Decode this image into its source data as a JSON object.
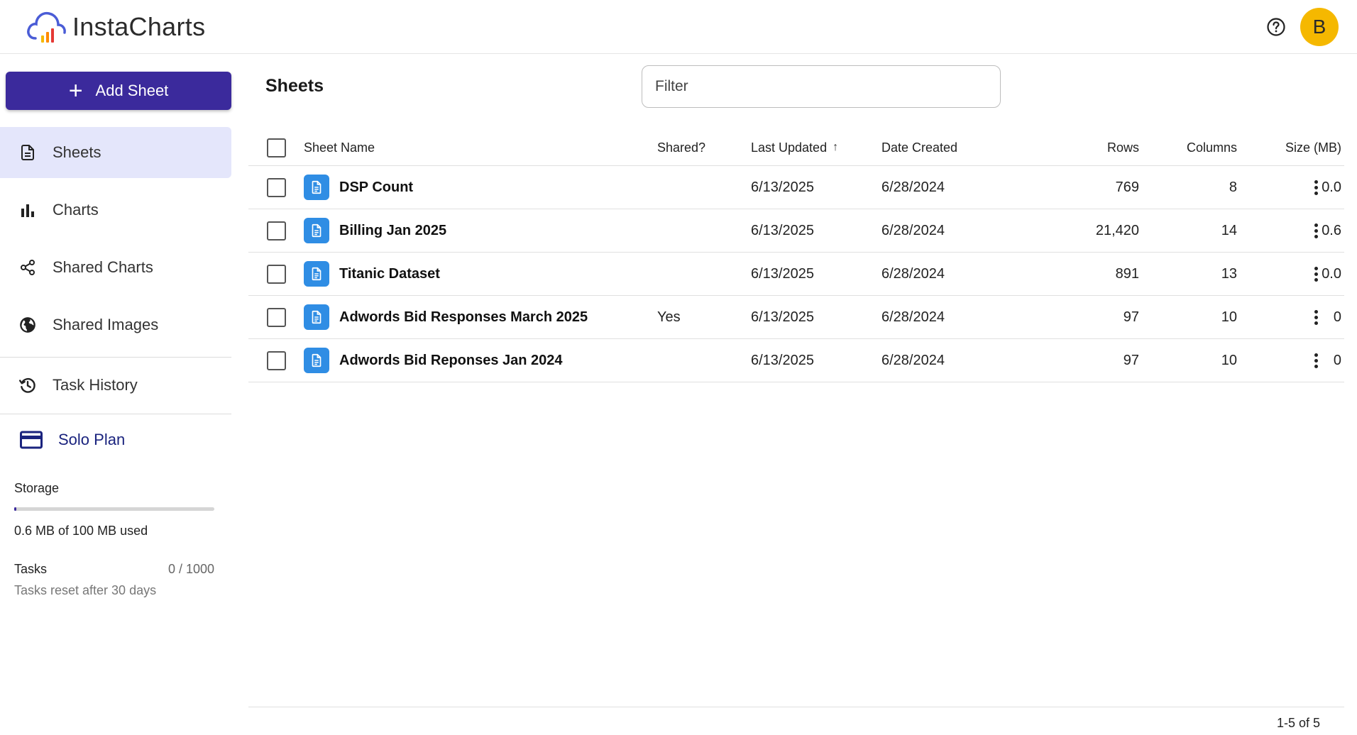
{
  "app": {
    "name": "InstaCharts",
    "user_initial": "B",
    "accent_color": "#3b2a9c",
    "avatar_color": "#f5b800"
  },
  "sidebar": {
    "add_button_label": "Add Sheet",
    "items": [
      {
        "label": "Sheets",
        "icon": "document-icon",
        "active": true
      },
      {
        "label": "Charts",
        "icon": "bar-chart-icon",
        "active": false
      },
      {
        "label": "Shared Charts",
        "icon": "share-icon",
        "active": false
      },
      {
        "label": "Shared Images",
        "icon": "globe-icon",
        "active": false
      },
      {
        "label": "Task History",
        "icon": "history-icon",
        "active": false
      }
    ],
    "plan": {
      "label": "Solo Plan",
      "icon": "credit-card-icon"
    },
    "storage": {
      "label": "Storage",
      "used_text": "0.6 MB of 100 MB used",
      "used_fraction": 0.006
    },
    "tasks": {
      "label": "Tasks",
      "count": "0 / 1000",
      "reset_note": "Tasks reset after 30 days"
    }
  },
  "main": {
    "title": "Sheets",
    "filter_placeholder": "Filter",
    "columns": {
      "name": "Sheet Name",
      "shared": "Shared?",
      "updated": "Last Updated",
      "created": "Date Created",
      "rows": "Rows",
      "cols": "Columns",
      "size": "Size (MB)"
    },
    "sort": {
      "column": "updated",
      "direction": "ascending"
    },
    "rows": [
      {
        "name": "DSP Count",
        "shared": "",
        "updated": "6/13/2025",
        "created": "6/28/2024",
        "rows": "769",
        "cols": "8",
        "size": "0.0"
      },
      {
        "name": "Billing Jan 2025",
        "shared": "",
        "updated": "6/13/2025",
        "created": "6/28/2024",
        "rows": "21,420",
        "cols": "14",
        "size": "0.6"
      },
      {
        "name": "Titanic Dataset",
        "shared": "",
        "updated": "6/13/2025",
        "created": "6/28/2024",
        "rows": "891",
        "cols": "13",
        "size": "0.0"
      },
      {
        "name": "Adwords Bid Responses March 2025",
        "shared": "Yes",
        "updated": "6/13/2025",
        "created": "6/28/2024",
        "rows": "97",
        "cols": "10",
        "size": "0"
      },
      {
        "name": "Adwords Bid Reponses Jan 2024",
        "shared": "",
        "updated": "6/13/2025",
        "created": "6/28/2024",
        "rows": "97",
        "cols": "10",
        "size": "0"
      }
    ],
    "pagination": "1-5 of 5"
  }
}
